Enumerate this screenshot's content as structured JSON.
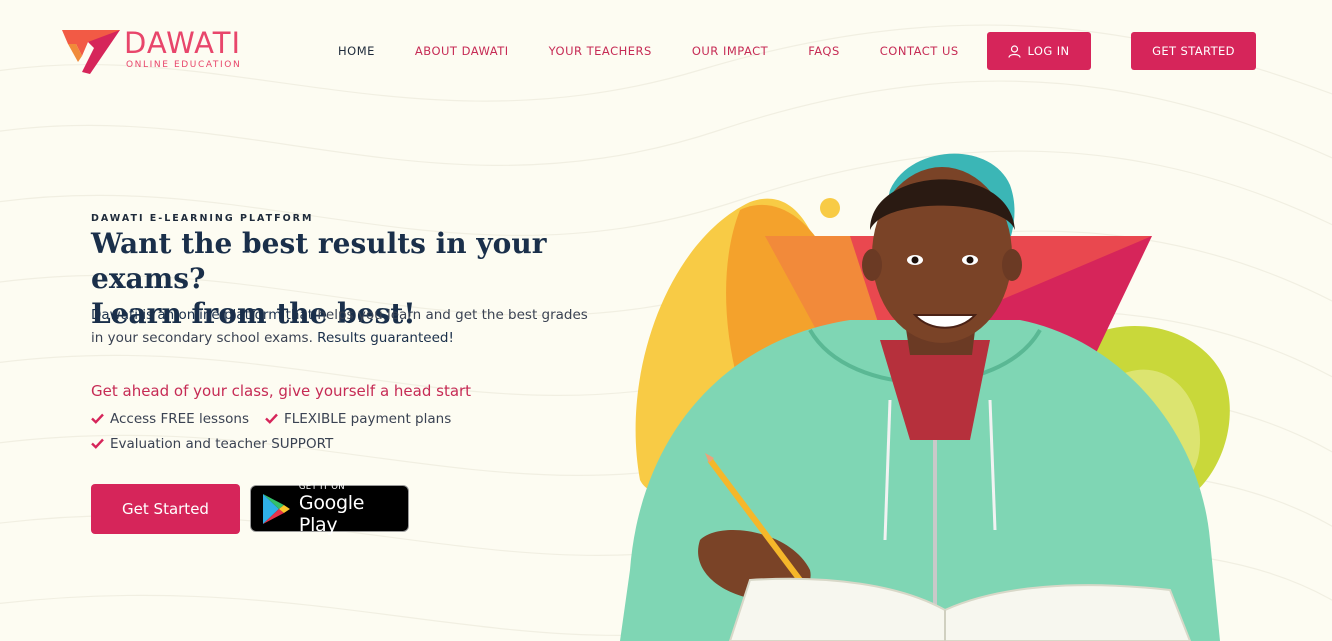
{
  "brand": {
    "name": "DAWATI",
    "tagline": "ONLINE EDUCATION",
    "colors": {
      "primary": "#d6255a",
      "text": "#1a2f4a",
      "background": "#fdfcf2"
    }
  },
  "nav": {
    "items": [
      {
        "label": "HOME",
        "active": true
      },
      {
        "label": "ABOUT DAWATI",
        "active": false
      },
      {
        "label": "YOUR TEACHERS",
        "active": false
      },
      {
        "label": "OUR IMPACT",
        "active": false
      },
      {
        "label": "FAQS",
        "active": false
      },
      {
        "label": "CONTACT US",
        "active": false
      }
    ],
    "login_label": "LOG IN",
    "get_started_label": "GET STARTED",
    "login_icon": "user-icon"
  },
  "hero": {
    "eyebrow": "DAWATI E-LEARNING PLATFORM",
    "headline_line1": "Want the best results in your exams?",
    "headline_line2": "Learn from the best!",
    "desc_part1": "Dawati is an online platform that",
    "desc_part2": " helps you learn and get the best grades in your secondary school exams. ",
    "desc_part3": "Results guaranteed!",
    "tagline": "Get ahead of your class, give yourself a head start",
    "features": [
      "Access FREE lessons",
      "FLEXIBLE payment plans",
      "Evaluation and teacher SUPPORT"
    ],
    "feature_icon": "check-icon",
    "cta_label": "Get Started",
    "store_badge": {
      "small": "GET IT ON",
      "big": "Google Play",
      "icon": "google-play-icon"
    }
  }
}
